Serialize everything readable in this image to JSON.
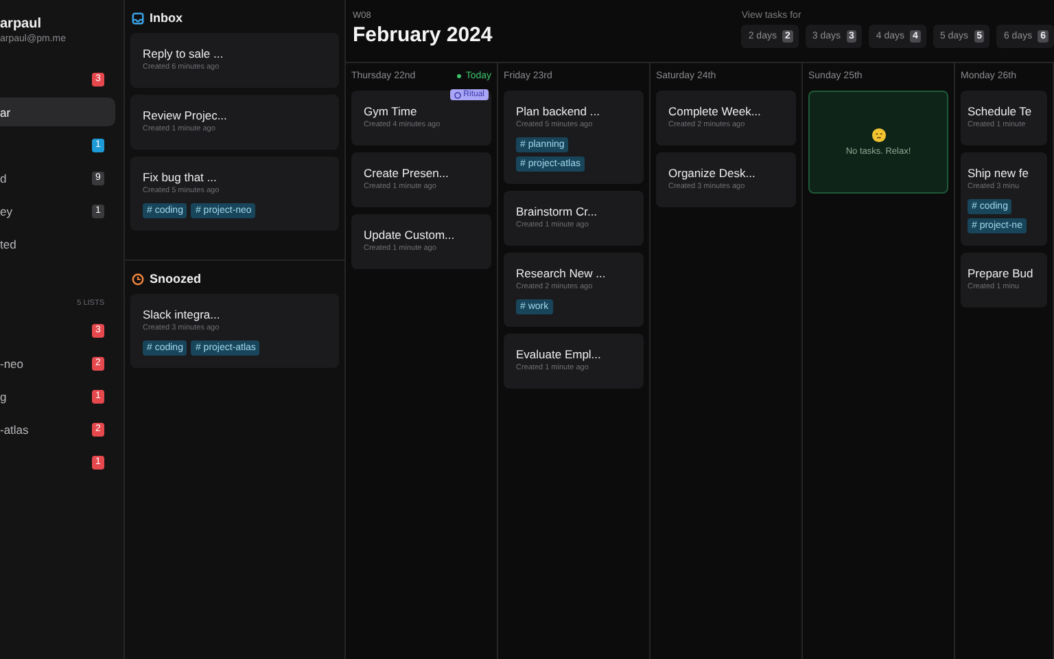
{
  "sidebar": {
    "user": {
      "name": "arpaul",
      "email": "arpaul@pm.me"
    },
    "nav": [
      {
        "badge": "3",
        "color": "#e5484d",
        "selected": false
      },
      {
        "label": "ar",
        "selected": true
      },
      {
        "badge": "1",
        "color": "#1e9ad6",
        "selected": false
      },
      {
        "label": "d",
        "badge": "9",
        "color": "#3a3a3d",
        "selected": false
      },
      {
        "label": "ey",
        "badge": "1",
        "color": "#3a3a3d",
        "selected": false
      },
      {
        "label": "ted",
        "selected": false
      }
    ],
    "lists_count": "5 LISTS",
    "lists": [
      {
        "badge": "3",
        "color": "#e5484d"
      },
      {
        "label": "-neo",
        "badge": "2",
        "color": "#e5484d"
      },
      {
        "label": "g",
        "badge": "1",
        "color": "#e5484d"
      },
      {
        "label": "-atlas",
        "badge": "2",
        "color": "#e5484d"
      },
      {
        "badge": "1",
        "color": "#e5484d"
      }
    ]
  },
  "inbox": {
    "title": "Inbox",
    "tasks": [
      {
        "title": "Reply to sale ...",
        "created": "Created 6 minutes ago"
      },
      {
        "title": "Review Projec...",
        "created": "Created 1 minute ago"
      },
      {
        "title": "Fix bug that ...",
        "created": "Created 5 minutes ago",
        "tags": [
          "# coding",
          "# project-neo"
        ]
      }
    ]
  },
  "snoozed": {
    "title": "Snoozed",
    "tasks": [
      {
        "title": "Slack integra...",
        "created": "Created 3 minutes ago",
        "tags": [
          "# coding",
          "# project-atlas"
        ]
      }
    ]
  },
  "header": {
    "week": "W08",
    "title": "February 2024",
    "view_label": "View tasks for",
    "options": [
      {
        "label": "2 days",
        "key": "2"
      },
      {
        "label": "3 days",
        "key": "3"
      },
      {
        "label": "4 days",
        "key": "4"
      },
      {
        "label": "5 days",
        "key": "5"
      },
      {
        "label": "6 days",
        "key": "6"
      }
    ]
  },
  "days": [
    {
      "label": "Thursday 22nd",
      "today": "Today",
      "tasks": [
        {
          "title": "Gym Time",
          "created": "Created 4 minutes ago",
          "badge": "Ritual"
        },
        {
          "title": "Create Presen...",
          "created": "Created 1 minute ago"
        },
        {
          "title": "Update Custom...",
          "created": "Created 1 minute ago"
        }
      ]
    },
    {
      "label": "Friday 23rd",
      "tasks": [
        {
          "title": "Plan backend ...",
          "created": "Created 5 minutes ago",
          "tags": [
            "# planning",
            "# project-atlas"
          ]
        },
        {
          "title": "Brainstorm Cr...",
          "created": "Created 1 minute ago"
        },
        {
          "title": "Research New ...",
          "created": "Created 2 minutes ago",
          "tags": [
            "# work"
          ]
        },
        {
          "title": "Evaluate Empl...",
          "created": "Created 1 minute ago"
        }
      ]
    },
    {
      "label": "Saturday 24th",
      "tasks": [
        {
          "title": "Complete Week...",
          "created": "Created 2 minutes ago"
        },
        {
          "title": "Organize Desk...",
          "created": "Created 3 minutes ago"
        }
      ]
    },
    {
      "label": "Sunday 25th",
      "empty": "No tasks. Relax!"
    },
    {
      "label": "Monday 26th",
      "tasks": [
        {
          "title": "Schedule Te",
          "created": "Created 1 minute"
        },
        {
          "title": "Ship new fe",
          "created": "Created 3 minu",
          "tags": [
            "# coding",
            "# project-ne"
          ]
        },
        {
          "title": "Prepare Bud",
          "created": "Created 1 minu"
        }
      ]
    }
  ]
}
